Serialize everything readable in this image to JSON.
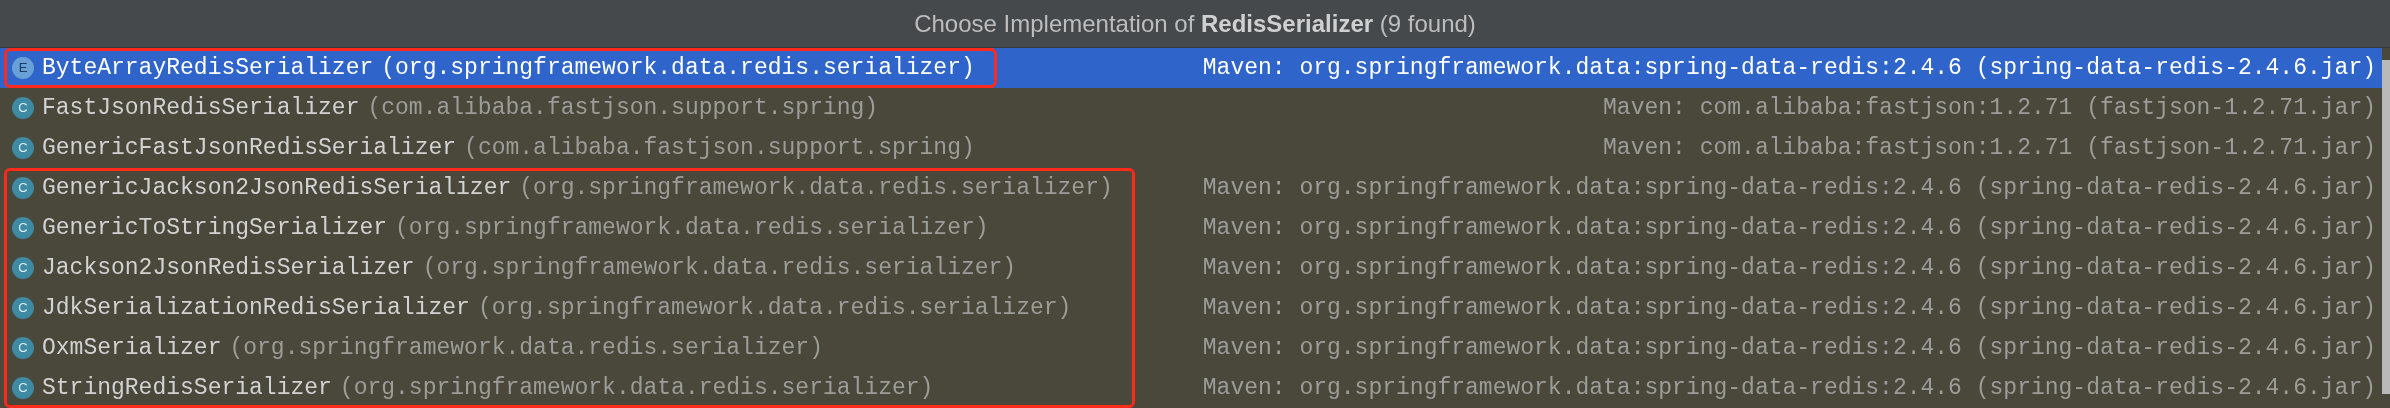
{
  "title": "Choose Implementation of **RedisSerializer** (9 found)",
  "items": [
    {
      "icon_letter": "E",
      "name": "ByteArrayRedisSerializer",
      "package": "(org.springframework.data.redis.serializer)",
      "library": "Maven: org.springframework.data:spring-data-redis:2.4.6 (spring-data-redis-2.4.6.jar)",
      "selected": true,
      "marked": true
    },
    {
      "icon_letter": "C",
      "name": "FastJsonRedisSerializer",
      "package": "(com.alibaba.fastjson.support.spring)",
      "library": "Maven: com.alibaba:fastjson:1.2.71 (fastjson-1.2.71.jar)",
      "selected": false,
      "marked": false
    },
    {
      "icon_letter": "C",
      "name": "GenericFastJsonRedisSerializer",
      "package": "(com.alibaba.fastjson.support.spring)",
      "library": "Maven: com.alibaba:fastjson:1.2.71 (fastjson-1.2.71.jar)",
      "selected": false,
      "marked": false
    },
    {
      "icon_letter": "C",
      "name": "GenericJackson2JsonRedisSerializer",
      "package": "(org.springframework.data.redis.serializer)",
      "library": "Maven: org.springframework.data:spring-data-redis:2.4.6 (spring-data-redis-2.4.6.jar)",
      "selected": false,
      "marked": true
    },
    {
      "icon_letter": "C",
      "name": "GenericToStringSerializer",
      "package": "(org.springframework.data.redis.serializer)",
      "library": "Maven: org.springframework.data:spring-data-redis:2.4.6 (spring-data-redis-2.4.6.jar)",
      "selected": false,
      "marked": true
    },
    {
      "icon_letter": "C",
      "name": "Jackson2JsonRedisSerializer",
      "package": "(org.springframework.data.redis.serializer)",
      "library": "Maven: org.springframework.data:spring-data-redis:2.4.6 (spring-data-redis-2.4.6.jar)",
      "selected": false,
      "marked": true
    },
    {
      "icon_letter": "C",
      "name": "JdkSerializationRedisSerializer",
      "package": "(org.springframework.data.redis.serializer)",
      "library": "Maven: org.springframework.data:spring-data-redis:2.4.6 (spring-data-redis-2.4.6.jar)",
      "selected": false,
      "marked": true
    },
    {
      "icon_letter": "C",
      "name": "OxmSerializer",
      "package": "(org.springframework.data.redis.serializer)",
      "library": "Maven: org.springframework.data:spring-data-redis:2.4.6 (spring-data-redis-2.4.6.jar)",
      "selected": false,
      "marked": true
    },
    {
      "icon_letter": "C",
      "name": "StringRedisSerializer",
      "package": "(org.springframework.data.redis.serializer)",
      "library": "Maven: org.springframework.data:spring-data-redis:2.4.6 (spring-data-redis-2.4.6.jar)",
      "selected": false,
      "marked": true
    }
  ]
}
